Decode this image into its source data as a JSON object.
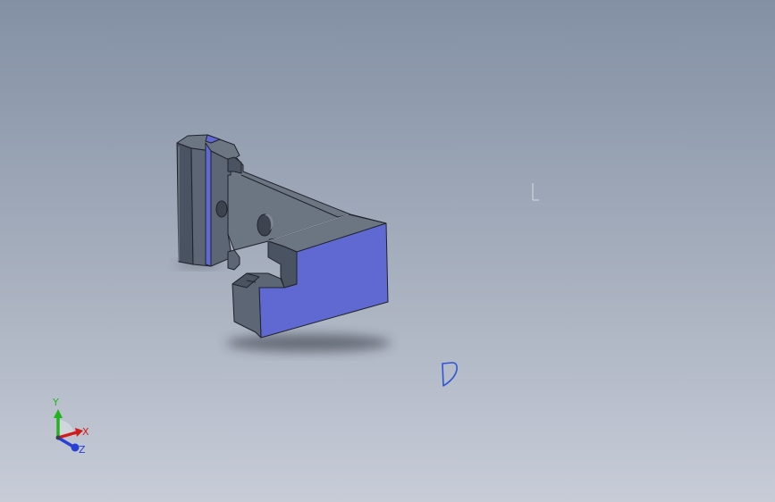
{
  "viewport": {
    "background_top": "#8390a4",
    "background_bottom": "#c7ccd7"
  },
  "model": {
    "face_dark": "#4a5361",
    "face_mid": "#5d6674",
    "face_light": "#6c7582",
    "face_selected": "#6068d2",
    "edge_color": "#1f232b",
    "shadow_color": "#2c323b"
  },
  "triad": {
    "y_label": "Y",
    "x_label": "X",
    "z_label": "Z",
    "y_color": "#22b41e",
    "x_color": "#d11c1c",
    "z_color": "#2a3fd6"
  },
  "origin_icon": "origin-icon",
  "sketch_icon": "sketch-plane-icon"
}
